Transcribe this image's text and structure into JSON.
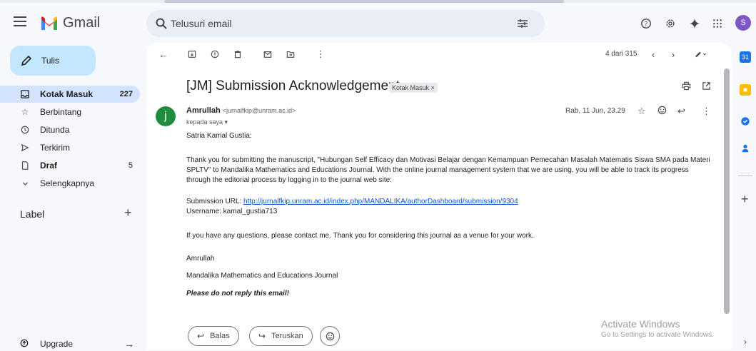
{
  "header": {
    "app_name": "Gmail",
    "search_placeholder": "Telusuri email",
    "avatar_letter": "S"
  },
  "sidebar": {
    "compose_label": "Tulis",
    "items": [
      {
        "label": "Kotak Masuk",
        "count": "227",
        "active": true,
        "icon": "inbox-icon"
      },
      {
        "label": "Berbintang",
        "count": "",
        "icon": "star-icon"
      },
      {
        "label": "Ditunda",
        "count": "",
        "icon": "clock-icon"
      },
      {
        "label": "Terkirim",
        "count": "",
        "icon": "send-icon"
      },
      {
        "label": "Draf",
        "count": "5",
        "bold": true,
        "icon": "draft-icon"
      },
      {
        "label": "Selengkapnya",
        "count": "",
        "icon": "chevron-down-icon"
      }
    ],
    "label_heading": "Label",
    "upgrade_label": "Upgrade"
  },
  "toolbar": {
    "pager": "4 dari 315"
  },
  "email": {
    "subject": "[JM] Submission Acknowledgement",
    "chip_label": "Kotak Masuk ×",
    "sender_initial": "j",
    "sender_name": "Amrullah",
    "sender_email": "<jurnalfkip@unram.ac.id>",
    "to_me": "kepada saya ▾",
    "date": "Rab, 11 Jun, 23.29",
    "greeting": "Satria Kamal Gustia:",
    "para1": "Thank you for submitting the manuscript, \"Hubungan Self Efficacy dan Motivasi Belajar dengan Kemampuan Pemecahan Masalah Matematis Siswa SMA pada Materi SPLTV\" to Mandalika Mathematics and Educations Journal. With the online journal management system that we are using, you will be able to track its progress through the editorial process by logging in to the journal web site:",
    "url_label": "Submission URL: ",
    "url": "http://jurnalfkip.unram.ac.id/index.php/MANDALIKA/authorDashboard/submission/9304",
    "username_line": "Username: kamal_gustia713",
    "para2": "If you have any questions, please contact me. Thank you for considering this journal as a venue for your work.",
    "sign_name": "Amrullah",
    "sign_journal": "Mandalika Mathematics and Educations Journal",
    "noreply": "Please do not reply this email!"
  },
  "actions": {
    "reply_label": "Balas",
    "forward_label": "Teruskan"
  },
  "watermark": {
    "line1": "Activate Windows",
    "line2": "Go to Settings to activate Windows."
  },
  "colors": {
    "compose_bg": "#c2e7ff",
    "active_nav": "#d3e3fd",
    "sender_avatar": "#1e8e3e",
    "user_avatar": "#7e57c2",
    "link": "#1155cc"
  }
}
